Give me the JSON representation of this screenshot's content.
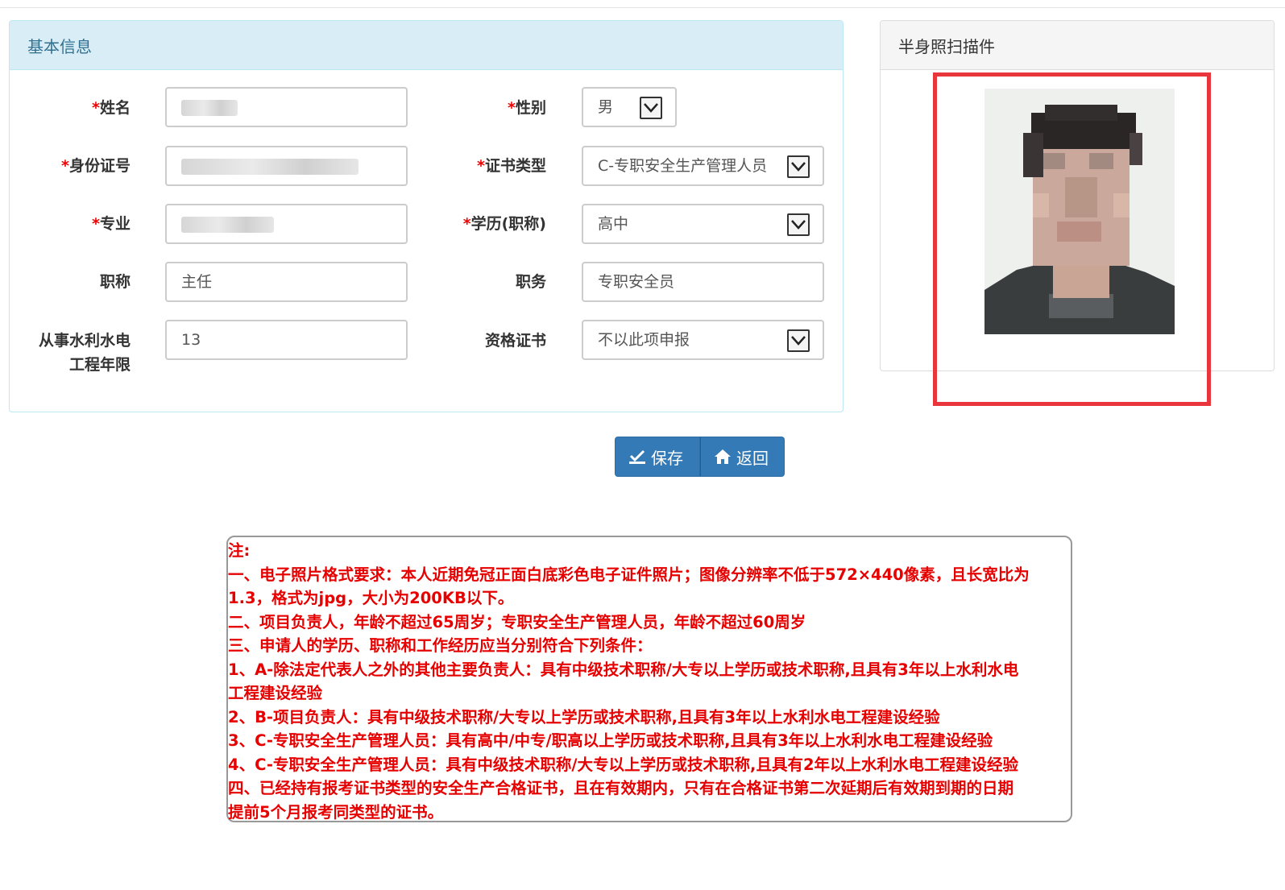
{
  "basic_info": {
    "title": "基本信息",
    "fields": {
      "name": {
        "label": "姓名",
        "required": "*",
        "value": ""
      },
      "gender": {
        "label": "性别",
        "required": "*",
        "value": "男"
      },
      "id_number": {
        "label": "身份证号",
        "required": "*",
        "value": ""
      },
      "cert_type": {
        "label": "证书类型",
        "required": "*",
        "value": "C-专职安全生产管理人员"
      },
      "major": {
        "label": "专业",
        "required": "*",
        "value": ""
      },
      "education": {
        "label": "学历(职称)",
        "required": "*",
        "value": "高中"
      },
      "title": {
        "label": "职称",
        "value": "主任"
      },
      "position": {
        "label": "职务",
        "value": "专职安全员"
      },
      "years_line1": "从事水利水电",
      "years_line2": "工程年限",
      "years_value": "13",
      "qualification": {
        "label": "资格证书",
        "value": "不以此项申报"
      }
    }
  },
  "photo_panel": {
    "title": "半身照扫描件"
  },
  "actions": {
    "save_label": "保存",
    "back_label": "返回",
    "primary_color": "#337ab7"
  },
  "notes": {
    "color": "#e60000",
    "lines": [
      "注:",
      "一、电子照片格式要求：本人近期免冠正面白底彩色电子证件照片；图像分辨率不低于572×440像素，且长宽比为",
      "1.3，格式为jpg，大小为200KB以下。",
      "二、项目负责人，年龄不超过65周岁；专职安全生产管理人员，年龄不超过60周岁",
      "三、申请人的学历、职称和工作经历应当分别符合下列条件：",
      "1、A-除法定代表人之外的其他主要负责人：具有中级技术职称/大专以上学历或技术职称,且具有3年以上水利水电",
      "工程建设经验",
      "2、B-项目负责人：具有中级技术职称/大专以上学历或技术职称,且具有3年以上水利水电工程建设经验",
      "3、C-专职安全生产管理人员：具有高中/中专/职高以上学历或技术职称,且具有3年以上水利水电工程建设经验",
      "4、C-专职安全生产管理人员：具有中级技术职称/大专以上学历或技术职称,且具有2年以上水利水电工程建设经验",
      "四、已经持有报考证书类型的安全生产合格证书，且在有效期内，只有在合格证书第二次延期后有效期到期的日期",
      "提前5个月报考同类型的证书。"
    ]
  }
}
